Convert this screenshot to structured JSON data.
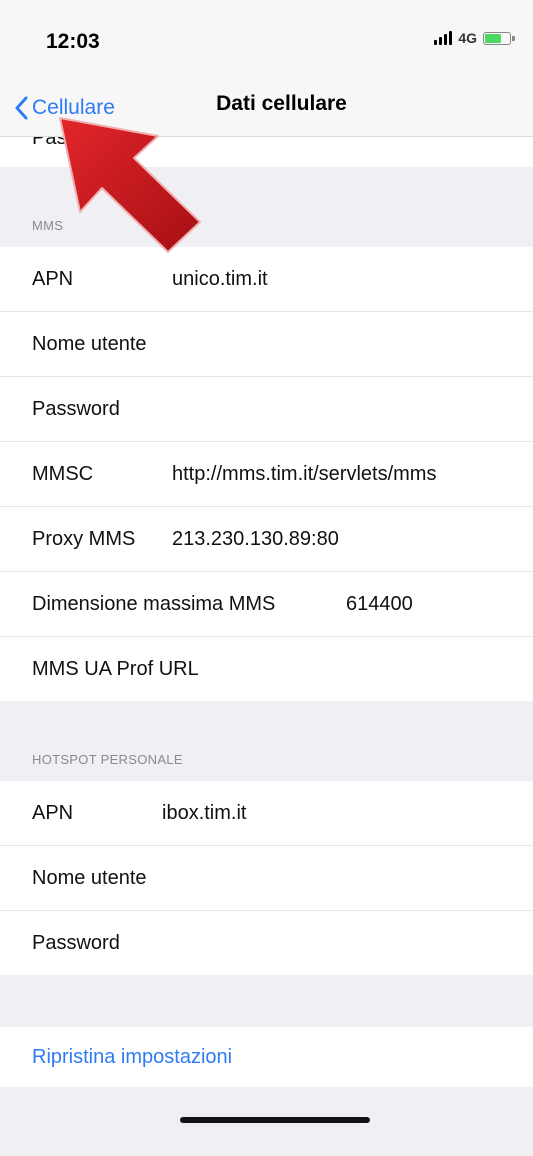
{
  "status_bar": {
    "time": "12:03",
    "network": "4G",
    "battery_level": 0.6,
    "battery_color": "#4cd964"
  },
  "nav": {
    "back_label": "Cellulare",
    "back_icon": "chevron-left-icon",
    "title": "Dati cellulare",
    "accent": "#2f7bf6"
  },
  "partial_row": {
    "label": "Pas"
  },
  "mms": {
    "header": "MMS",
    "rows": [
      {
        "label": "APN",
        "value": "unico.tim.it"
      },
      {
        "label": "Nome utente",
        "value": ""
      },
      {
        "label": "Password",
        "value": ""
      },
      {
        "label": "MMSC",
        "value": "http://mms.tim.it/servlets/mms"
      },
      {
        "label": "Proxy MMS",
        "value": "213.230.130.89:80"
      },
      {
        "label": "Dimensione massima MMS",
        "value": "614400"
      },
      {
        "label": "MMS UA Prof URL",
        "value": ""
      }
    ]
  },
  "hotspot": {
    "header": "HOTSPOT PERSONALE",
    "rows": [
      {
        "label": "APN",
        "value": "ibox.tim.it"
      },
      {
        "label": "Nome utente",
        "value": ""
      },
      {
        "label": "Password",
        "value": ""
      }
    ]
  },
  "reset": {
    "label": "Ripristina impostazioni",
    "color": "#2f7bf6"
  },
  "annotation": {
    "icon": "red-arrow-icon",
    "color": "#d0161b"
  }
}
